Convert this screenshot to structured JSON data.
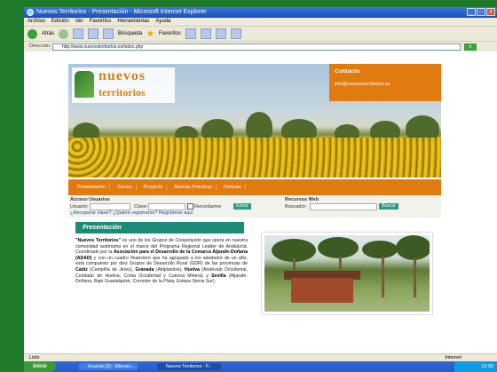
{
  "window": {
    "title": "Nuevos Territorios - Presentación - Microsoft Internet Explorer",
    "buttons": [
      "_",
      "□",
      "X"
    ]
  },
  "menubar": [
    "Archivo",
    "Edición",
    "Ver",
    "Favoritos",
    "Herramientas",
    "Ayuda"
  ],
  "toolbar": {
    "back_label": "Atrás",
    "search_label": "Búsqueda",
    "favorites_label": "Favoritos"
  },
  "addressbar": {
    "label": "Dirección",
    "url": "http://www.nuevosterritorios.es/index.php",
    "go_label": "Ir"
  },
  "site": {
    "logo_line1": "nuevos",
    "logo_line2": "territorios",
    "contact_title": "Contacto",
    "contact_email": "info@nuevosterritorios.es",
    "nav": [
      "Presentación",
      "Socios",
      "Proyecto",
      "Buenas Prácticas",
      "Noticias"
    ],
    "login": {
      "section_label": "Acceso Usuarios",
      "user_label": "Usuario:",
      "password_label": "Clave:",
      "remember_label": "Recordarme",
      "enter_label": "Entrar",
      "links": "¿Recuperar clave?  ¿Quiere registrarse? Regístrese aquí"
    },
    "resources": {
      "section_label": "Recursos Web",
      "search_label": "Buscador:",
      "search_button": "Buscar"
    },
    "presentation": {
      "title": "Presentación",
      "intro_bold": "\"Nuevos Territorios\"",
      "text_1": " es uno de los Grupos de Cooperación que opera en nuestra comunidad autónoma en el marco del Programa Regional Leader de Andalucía. Coordinado por la ",
      "assoc_bold": "Asociación para el Desarrollo de la Comarca Aljarafe-Doñana (ADAD)",
      "text_2": " y con un cuadro financiero que ha agrupado a los alrededor de un año, está compuesto por diez Grupos de Desarrollo Rural (GDR) de las provincias de ",
      "cadiz_bold": "Cádiz",
      "text_3": " (Campiña de Jerez), ",
      "granada_bold": "Granada",
      "text_4": " (Altiplanicie), ",
      "huelva_bold": "Huelva",
      "text_5": " (Andévalo Occidental, Condado de Huelva, Costa Occidental y Cuenca Minera) y ",
      "sevilla_bold": "Sevilla",
      "text_6": " (Aljarafe-Doñana, Bajo Guadalquivir, Corredor de la Plata, Estepa Sierra Sur)."
    }
  },
  "statusbar": {
    "left": "Listo",
    "right": "Internet"
  },
  "taskbar": {
    "start_label": "Inicio",
    "tasks": [
      "Acuerdo (2) - Microso...",
      "Nuevos Territorios - P..."
    ],
    "clock": "12:00"
  }
}
